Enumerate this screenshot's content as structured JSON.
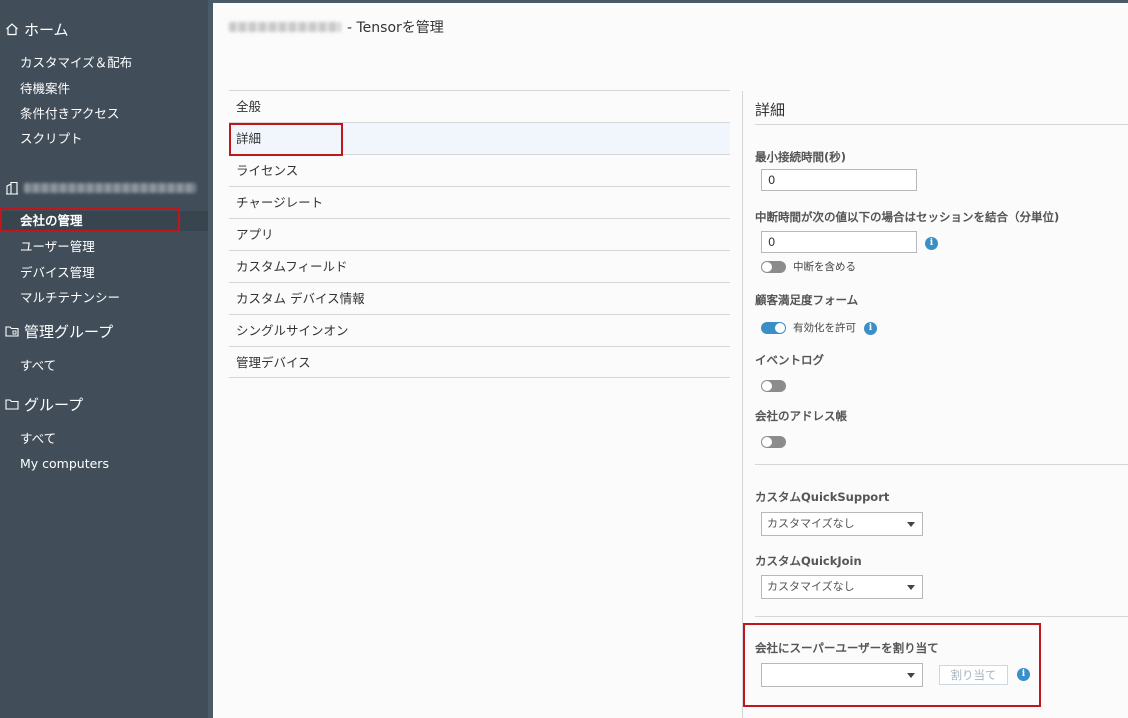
{
  "sidebar": {
    "home_label": "ホーム",
    "home_items": [
      "カスタマイズ＆配布",
      "待機案件",
      "条件付きアクセス",
      "スクリプト"
    ],
    "company_items": [
      "会社の管理",
      "ユーザー管理",
      "デバイス管理",
      "マルチテナンシー"
    ],
    "managed_groups_label": "管理グループ",
    "managed_groups_items": [
      "すべて"
    ],
    "groups_label": "グループ",
    "groups_items": [
      "すべて",
      "My computers"
    ]
  },
  "header": {
    "title_suffix": "- Tensorを管理"
  },
  "menu": {
    "items": [
      "全般",
      "詳細",
      "ライセンス",
      "チャージレート",
      "アプリ",
      "カスタムフィールド",
      "カスタム デバイス情報",
      "シングルサインオン",
      "管理デバイス"
    ]
  },
  "detail": {
    "title": "詳細",
    "min_conn_label": "最小接続時間(秒)",
    "min_conn_value": "0",
    "merge_label": "中断時間が次の値以下の場合はセッションを結合（分単位)",
    "merge_value": "0",
    "include_interrupt_label": "中断を含める",
    "satisfaction_label": "顧客満足度フォーム",
    "allow_enable_label": "有効化を許可",
    "event_log_label": "イベントログ",
    "address_book_label": "会社のアドレス帳",
    "quicksupport_label": "カスタムQuickSupport",
    "quicksupport_value": "カスタマイズなし",
    "quickjoin_label": "カスタムQuickJoin",
    "quickjoin_value": "カスタマイズなし",
    "superuser_label": "会社にスーパーユーザーを割り当て",
    "superuser_value": "",
    "assign_button": "割り当て"
  },
  "icons": {
    "info": "info-icon",
    "home": "home-icon",
    "building": "building-icon",
    "folder": "folder-icon"
  },
  "colors": {
    "sidebar_bg": "#414e59",
    "accent": "#3a8fc7",
    "highlight_red": "#c0171d"
  }
}
